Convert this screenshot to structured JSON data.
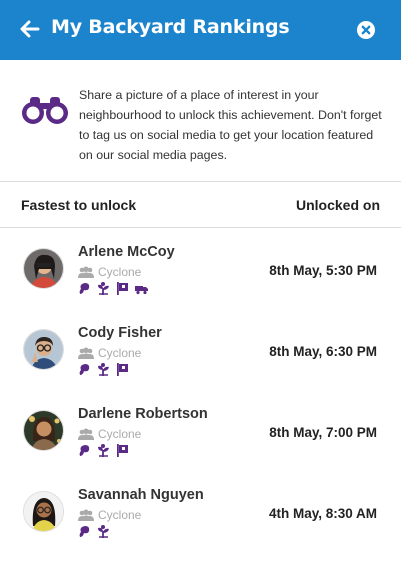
{
  "header": {
    "title": "My Backyard Rankings",
    "back_icon": "arrow-left-icon",
    "close_icon": "close-circle-icon",
    "color": "#1b84cc"
  },
  "intro": {
    "icon": "binoculars-icon",
    "text": "Share a picture of a place of interest in your neighbourhood to unlock this achievement. Don't forget to tag us on social media to get your location featured on our social media pages."
  },
  "columns": {
    "left": "Fastest to unlock",
    "right": "Unlocked on"
  },
  "accent": "#5b2a86",
  "rows": [
    {
      "name": "Arlene McCoy",
      "team": "Cyclone",
      "time": "8th May, 5:30 PM",
      "badges": [
        "bean",
        "sprout",
        "flag",
        "truck"
      ]
    },
    {
      "name": "Cody Fisher",
      "team": "Cyclone",
      "time": "8th May, 6:30 PM",
      "badges": [
        "bean",
        "sprout",
        "flag"
      ]
    },
    {
      "name": "Darlene Robertson",
      "team": "Cyclone",
      "time": "8th May, 7:00 PM",
      "badges": [
        "bean",
        "sprout",
        "flag"
      ]
    },
    {
      "name": "Savannah Nguyen",
      "team": "Cyclone",
      "time": "4th May, 8:30 AM",
      "badges": [
        "bean",
        "sprout"
      ]
    }
  ]
}
